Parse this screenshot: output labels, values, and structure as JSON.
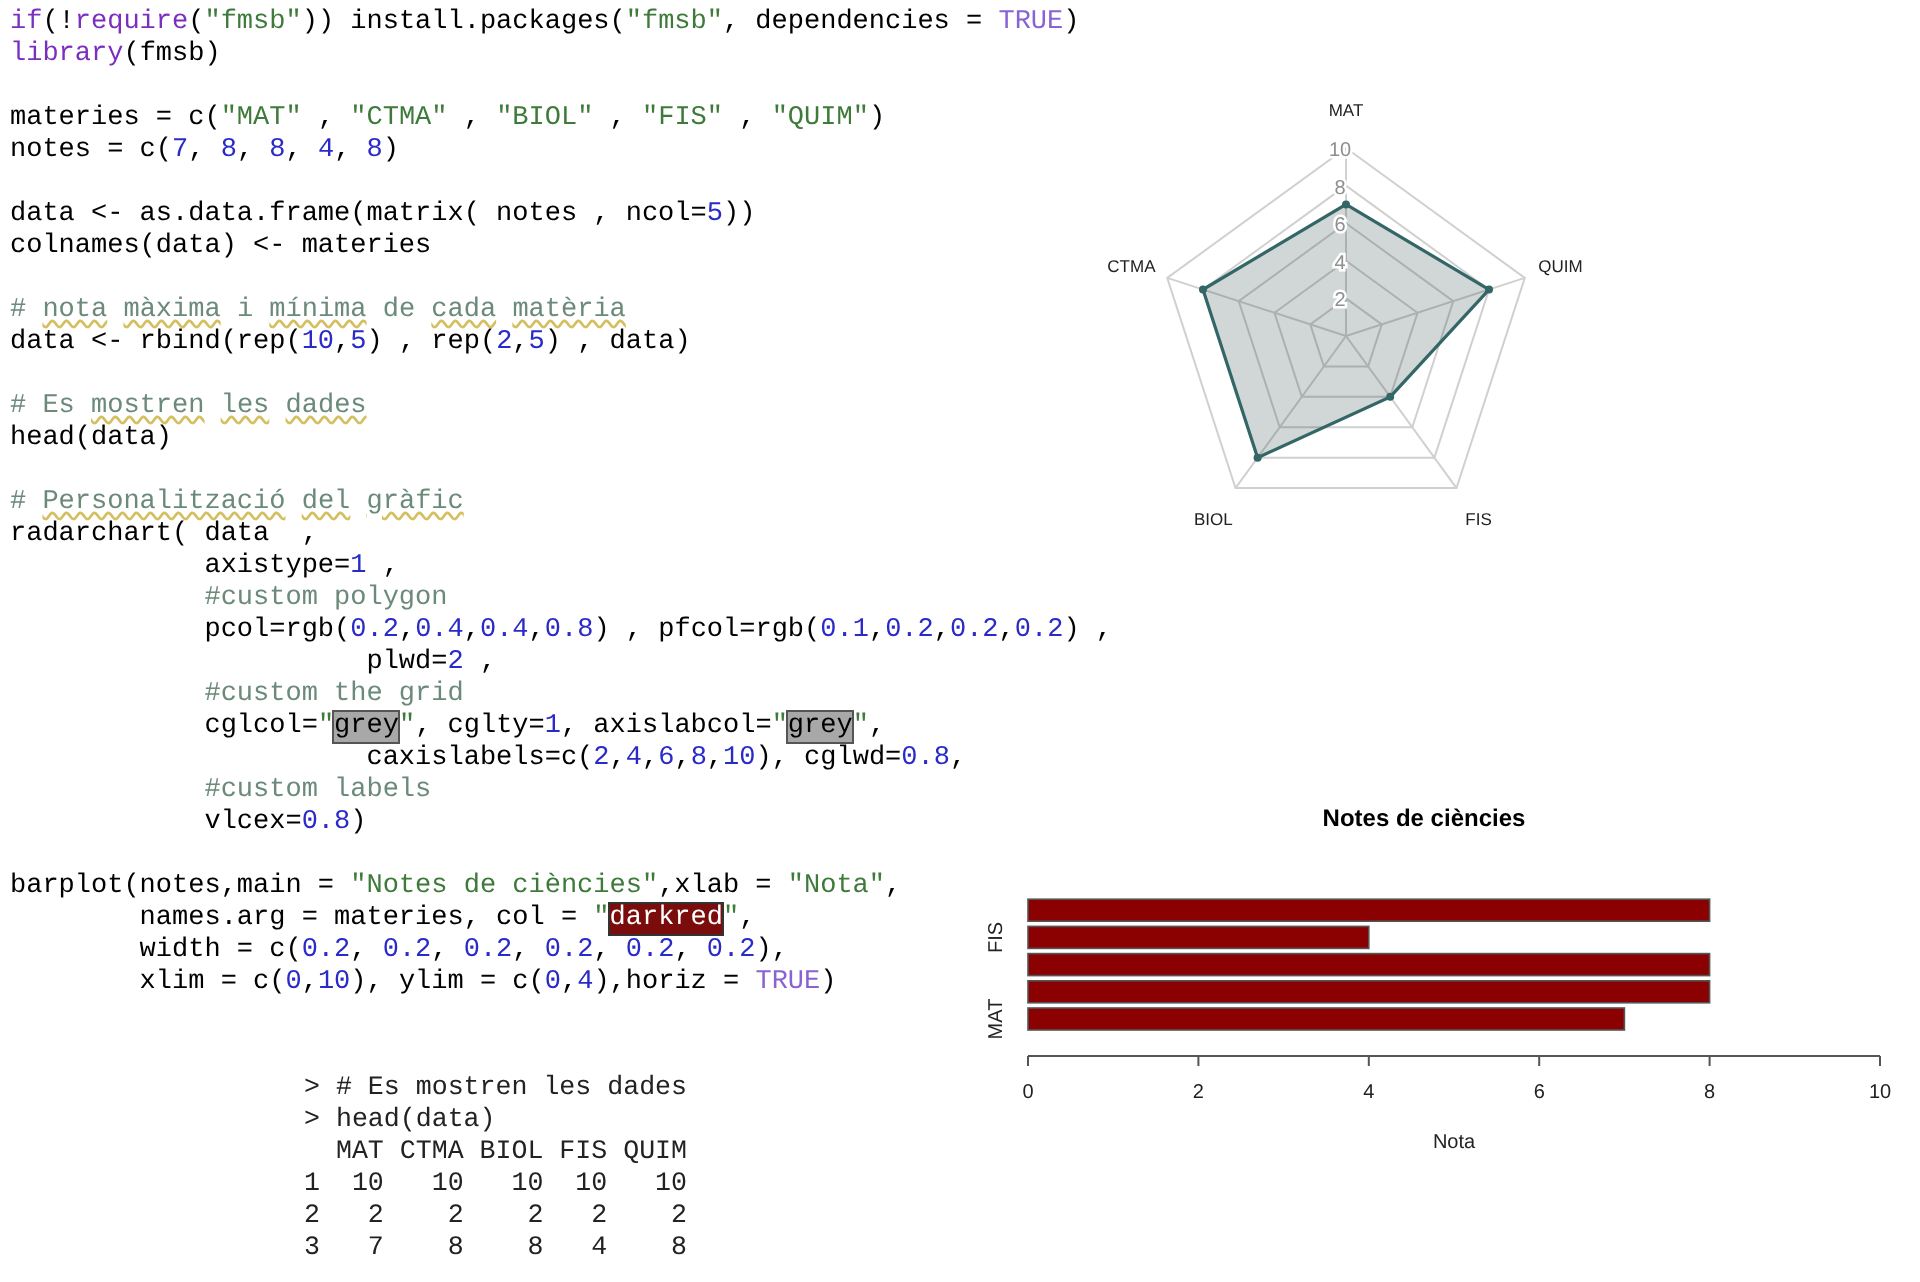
{
  "code": {
    "blocks": [
      [
        {
          "tokens": [
            {
              "kind": "keyword",
              "t": "if"
            },
            {
              "kind": "plain",
              "t": "(!"
            },
            {
              "kind": "keyword",
              "t": "require"
            },
            {
              "kind": "plain",
              "t": "("
            },
            {
              "kind": "string",
              "t": "\"fmsb\""
            },
            {
              "kind": "plain",
              "t": ")) install.packages("
            },
            {
              "kind": "string",
              "t": "\"fmsb\""
            },
            {
              "kind": "plain",
              "t": ", dependencies = "
            },
            {
              "kind": "constant",
              "t": "TRUE"
            },
            {
              "kind": "plain",
              "t": ")"
            }
          ]
        },
        {
          "tokens": [
            {
              "kind": "keyword",
              "t": "library"
            },
            {
              "kind": "plain",
              "t": "(fmsb)"
            }
          ]
        }
      ],
      [
        {
          "tokens": [
            {
              "kind": "plain",
              "t": "materies = c("
            },
            {
              "kind": "string",
              "t": "\"MAT\""
            },
            {
              "kind": "plain",
              "t": " , "
            },
            {
              "kind": "string",
              "t": "\"CTMA\""
            },
            {
              "kind": "plain",
              "t": " , "
            },
            {
              "kind": "string",
              "t": "\"BIOL\""
            },
            {
              "kind": "plain",
              "t": " , "
            },
            {
              "kind": "string",
              "t": "\"FIS\""
            },
            {
              "kind": "plain",
              "t": " , "
            },
            {
              "kind": "string",
              "t": "\"QUIM\""
            },
            {
              "kind": "plain",
              "t": ")"
            }
          ]
        },
        {
          "tokens": [
            {
              "kind": "plain",
              "t": "notes = c("
            },
            {
              "kind": "number",
              "t": "7"
            },
            {
              "kind": "plain",
              "t": ", "
            },
            {
              "kind": "number",
              "t": "8"
            },
            {
              "kind": "plain",
              "t": ", "
            },
            {
              "kind": "number",
              "t": "8"
            },
            {
              "kind": "plain",
              "t": ", "
            },
            {
              "kind": "number",
              "t": "4"
            },
            {
              "kind": "plain",
              "t": ", "
            },
            {
              "kind": "number",
              "t": "8"
            },
            {
              "kind": "plain",
              "t": ")"
            }
          ]
        }
      ],
      [
        {
          "tokens": [
            {
              "kind": "plain",
              "t": "data <- as.data.frame(matrix( notes , ncol="
            },
            {
              "kind": "number",
              "t": "5"
            },
            {
              "kind": "plain",
              "t": "))"
            }
          ]
        },
        {
          "tokens": [
            {
              "kind": "plain",
              "t": "colnames(data) <- materies"
            }
          ]
        }
      ],
      [
        {
          "tokens": [
            {
              "kind": "comment",
              "t": "# "
            },
            {
              "kind": "flagged",
              "t": "nota "
            },
            {
              "kind": "flagged",
              "t": "màxima "
            },
            {
              "kind": "comment",
              "t": "i "
            },
            {
              "kind": "flagged",
              "t": "mínima "
            },
            {
              "kind": "comment",
              "t": "de "
            },
            {
              "kind": "flagged",
              "t": "cada "
            },
            {
              "kind": "flagged",
              "t": "matèria"
            }
          ]
        },
        {
          "tokens": [
            {
              "kind": "plain",
              "t": "data <- rbind(rep("
            },
            {
              "kind": "number",
              "t": "10"
            },
            {
              "kind": "plain",
              "t": ","
            },
            {
              "kind": "number",
              "t": "5"
            },
            {
              "kind": "plain",
              "t": ") , rep("
            },
            {
              "kind": "number",
              "t": "2"
            },
            {
              "kind": "plain",
              "t": ","
            },
            {
              "kind": "number",
              "t": "5"
            },
            {
              "kind": "plain",
              "t": ") , data)"
            }
          ]
        }
      ],
      [
        {
          "tokens": [
            {
              "kind": "comment",
              "t": "# Es "
            },
            {
              "kind": "flagged",
              "t": "mostren "
            },
            {
              "kind": "flagged",
              "t": "les "
            },
            {
              "kind": "flagged",
              "t": "dades"
            }
          ]
        },
        {
          "tokens": [
            {
              "kind": "plain",
              "t": "head(data)"
            }
          ]
        }
      ],
      [
        {
          "tokens": [
            {
              "kind": "comment",
              "t": "# "
            },
            {
              "kind": "flagged",
              "t": "Personalització "
            },
            {
              "kind": "flagged",
              "t": "del "
            },
            {
              "kind": "flagged",
              "t": "gràfic"
            }
          ]
        },
        {
          "tokens": [
            {
              "kind": "plain",
              "t": "radarchart( data  ,"
            }
          ]
        },
        {
          "tokens": [
            {
              "kind": "plain",
              "t": "            axistype="
            },
            {
              "kind": "number",
              "t": "1"
            },
            {
              "kind": "plain",
              "t": " ,"
            }
          ]
        },
        {
          "tokens": [
            {
              "kind": "comment",
              "t": "            #custom polygon"
            }
          ]
        },
        {
          "tokens": [
            {
              "kind": "plain",
              "t": "            pcol=rgb("
            },
            {
              "kind": "number",
              "t": "0.2"
            },
            {
              "kind": "plain",
              "t": ","
            },
            {
              "kind": "number",
              "t": "0.4"
            },
            {
              "kind": "plain",
              "t": ","
            },
            {
              "kind": "number",
              "t": "0.4"
            },
            {
              "kind": "plain",
              "t": ","
            },
            {
              "kind": "number",
              "t": "0.8"
            },
            {
              "kind": "plain",
              "t": ") , pfcol=rgb("
            },
            {
              "kind": "number",
              "t": "0.1"
            },
            {
              "kind": "plain",
              "t": ","
            },
            {
              "kind": "number",
              "t": "0.2"
            },
            {
              "kind": "plain",
              "t": ","
            },
            {
              "kind": "number",
              "t": "0.2"
            },
            {
              "kind": "plain",
              "t": ","
            },
            {
              "kind": "number",
              "t": "0.2"
            },
            {
              "kind": "plain",
              "t": ") ,"
            }
          ]
        },
        {
          "tokens": [
            {
              "kind": "plain",
              "t": "                      plwd="
            },
            {
              "kind": "number",
              "t": "2"
            },
            {
              "kind": "plain",
              "t": " ,"
            }
          ]
        },
        {
          "tokens": [
            {
              "kind": "comment",
              "t": "            #custom the grid"
            }
          ]
        },
        {
          "tokens": [
            {
              "kind": "plain",
              "t": "            cglcol="
            },
            {
              "kind": "string",
              "t": "\""
            },
            {
              "kind": "grey_highlight",
              "t": "grey"
            },
            {
              "kind": "string",
              "t": "\""
            },
            {
              "kind": "plain",
              "t": ", cglty="
            },
            {
              "kind": "number",
              "t": "1"
            },
            {
              "kind": "plain",
              "t": ", axislabcol="
            },
            {
              "kind": "string",
              "t": "\""
            },
            {
              "kind": "grey_highlight",
              "t": "grey"
            },
            {
              "kind": "string",
              "t": "\""
            },
            {
              "kind": "plain",
              "t": ","
            }
          ]
        },
        {
          "tokens": [
            {
              "kind": "plain",
              "t": "                      caxislabels=c("
            },
            {
              "kind": "number",
              "t": "2"
            },
            {
              "kind": "plain",
              "t": ","
            },
            {
              "kind": "number",
              "t": "4"
            },
            {
              "kind": "plain",
              "t": ","
            },
            {
              "kind": "number",
              "t": "6"
            },
            {
              "kind": "plain",
              "t": ","
            },
            {
              "kind": "number",
              "t": "8"
            },
            {
              "kind": "plain",
              "t": ","
            },
            {
              "kind": "number",
              "t": "10"
            },
            {
              "kind": "plain",
              "t": "), cglwd="
            },
            {
              "kind": "number",
              "t": "0.8"
            },
            {
              "kind": "plain",
              "t": ","
            }
          ]
        },
        {
          "tokens": [
            {
              "kind": "comment",
              "t": "            #custom labels"
            }
          ]
        },
        {
          "tokens": [
            {
              "kind": "plain",
              "t": "            vlcex="
            },
            {
              "kind": "number",
              "t": "0.8"
            },
            {
              "kind": "plain",
              "t": ")"
            }
          ]
        }
      ],
      [
        {
          "tokens": [
            {
              "kind": "plain",
              "t": "barplot(notes,main = "
            },
            {
              "kind": "string",
              "t": "\"Notes de ciències\""
            },
            {
              "kind": "plain",
              "t": ",xlab = "
            },
            {
              "kind": "string",
              "t": "\"Nota\""
            },
            {
              "kind": "plain",
              "t": ","
            }
          ]
        },
        {
          "tokens": [
            {
              "kind": "plain",
              "t": "        names.arg = materies, col = "
            },
            {
              "kind": "string",
              "t": "\""
            },
            {
              "kind": "red_highlight",
              "t": "darkred"
            },
            {
              "kind": "string",
              "t": "\""
            },
            {
              "kind": "plain",
              "t": ","
            }
          ]
        },
        {
          "tokens": [
            {
              "kind": "plain",
              "t": "        width = c("
            },
            {
              "kind": "number",
              "t": "0.2"
            },
            {
              "kind": "plain",
              "t": ", "
            },
            {
              "kind": "number",
              "t": "0.2"
            },
            {
              "kind": "plain",
              "t": ", "
            },
            {
              "kind": "number",
              "t": "0.2"
            },
            {
              "kind": "plain",
              "t": ", "
            },
            {
              "kind": "number",
              "t": "0.2"
            },
            {
              "kind": "plain",
              "t": ", "
            },
            {
              "kind": "number",
              "t": "0.2"
            },
            {
              "kind": "plain",
              "t": ", "
            },
            {
              "kind": "number",
              "t": "0.2"
            },
            {
              "kind": "plain",
              "t": "),"
            }
          ]
        },
        {
          "tokens": [
            {
              "kind": "plain",
              "t": "        xlim = c("
            },
            {
              "kind": "number",
              "t": "0"
            },
            {
              "kind": "plain",
              "t": ","
            },
            {
              "kind": "number",
              "t": "10"
            },
            {
              "kind": "plain",
              "t": "), ylim = c("
            },
            {
              "kind": "number",
              "t": "0"
            },
            {
              "kind": "plain",
              "t": ","
            },
            {
              "kind": "number",
              "t": "4"
            },
            {
              "kind": "plain",
              "t": "),horiz = "
            },
            {
              "kind": "constant",
              "t": "TRUE"
            },
            {
              "kind": "plain",
              "t": ")"
            }
          ]
        }
      ]
    ]
  },
  "radar": {
    "chart_data": {
      "type": "radar",
      "categories": [
        "MAT",
        "QUIM",
        "FIS",
        "BIOL",
        "CTMA"
      ],
      "series": [
        {
          "color": "#336666",
          "values": [
            7,
            8,
            4,
            8,
            8
          ]
        }
      ],
      "ylim": [
        0,
        10
      ],
      "yticks": [
        2,
        4,
        6,
        8,
        10
      ]
    }
  },
  "barchart": {
    "chart_data": {
      "type": "bar",
      "orientation": "horizontal",
      "title": "Notes de ciències",
      "xlabel": "Nota",
      "categories": [
        null,
        "FIS",
        null,
        null,
        "MAT"
      ],
      "series": [
        {
          "color": "#8b0000",
          "values": [
            8,
            4,
            8,
            8,
            7
          ]
        }
      ],
      "xlim": [
        0,
        10
      ],
      "xticks": [
        0,
        2,
        4,
        6,
        8,
        10
      ]
    }
  },
  "console": {
    "lines": [
      "> # Es mostren les dades",
      "> head(data)",
      "  MAT CTMA BIOL FIS QUIM",
      "1  10   10   10  10   10",
      "2   2    2    2   2    2",
      "3   7    8    8   4    8"
    ]
  }
}
